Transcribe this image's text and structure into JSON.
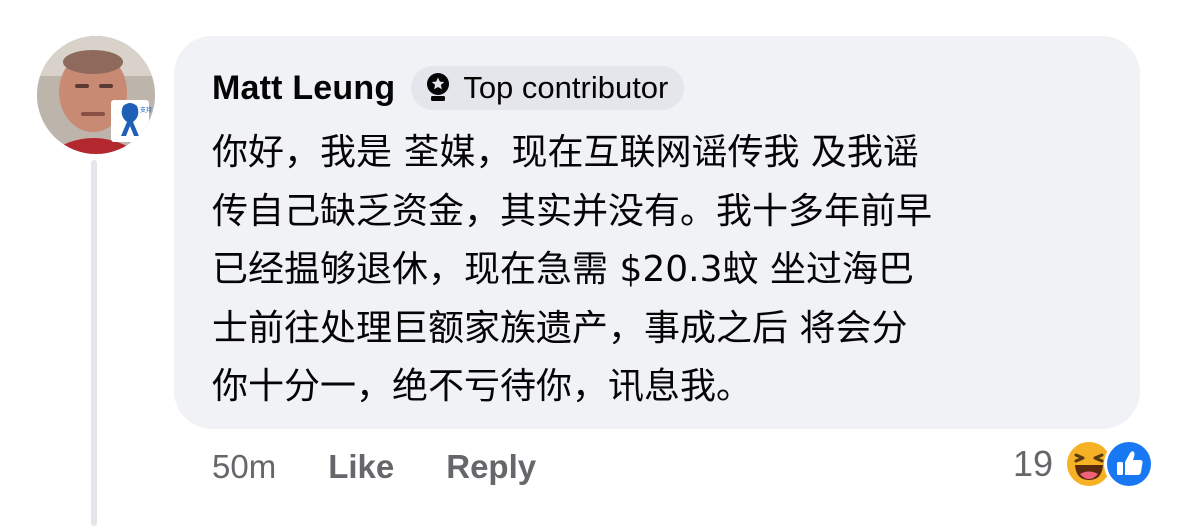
{
  "comment": {
    "author": "Matt Leung",
    "badge_label": "Top contributor",
    "text_lines": [
      "你好，我是 荃媒，现在互联网谣传我 及我谣",
      "传自己缺乏资金，其实并没有。我十多年前早",
      "已经揾够退休，现在急需 $20.3蚊 坐过海巴",
      "士前往处理巨额家族遗产，事成之后 将会分",
      "你十分一，绝不亏待你，讯息我。"
    ],
    "avatar_icon": "profile-photo-with-blue-ribbon",
    "avatar_ribbon_text": "支持 香港警察"
  },
  "actions": {
    "time": "50m",
    "like_label": "Like",
    "reply_label": "Reply"
  },
  "reactions": {
    "count": "19",
    "icons": [
      "haha-emoji-icon",
      "like-thumb-icon"
    ]
  },
  "colors": {
    "bubble_bg": "#f0f2f5",
    "badge_bg": "#e4e6eb",
    "secondary_text": "#65676b",
    "like_blue": "#1877f2",
    "haha_yellow": "#f7b125"
  }
}
